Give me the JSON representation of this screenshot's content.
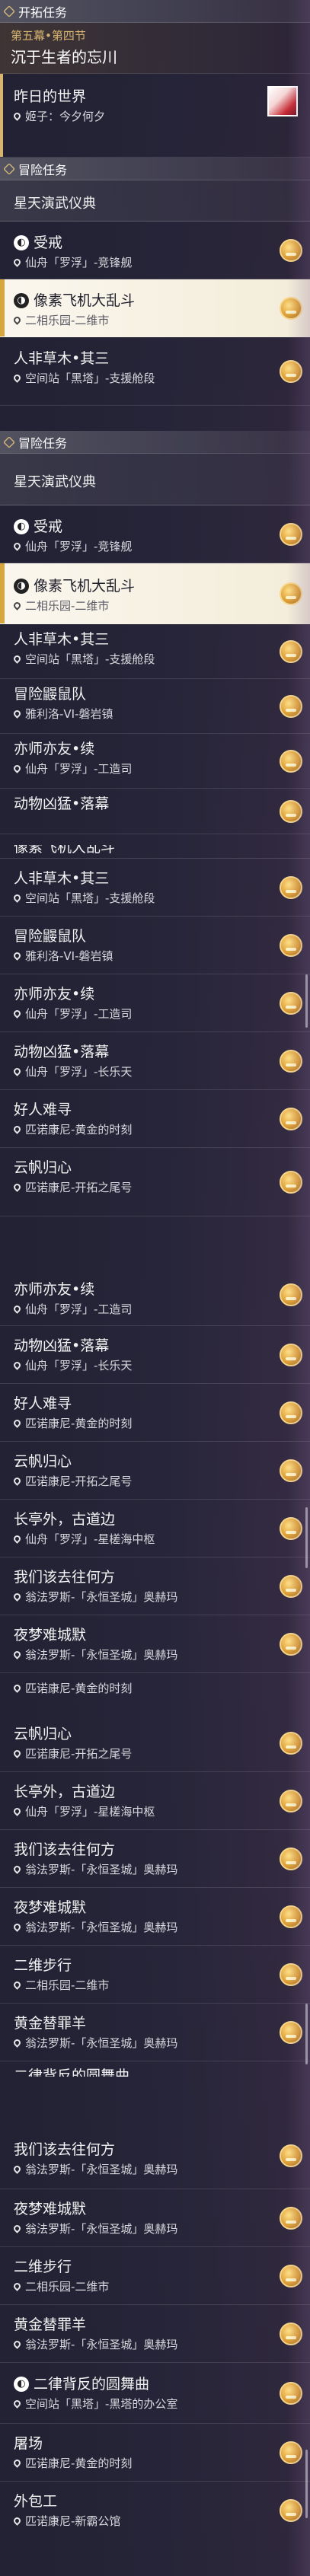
{
  "panel1": {
    "header": "开拓任务",
    "chapter": {
      "label": "第五幕•第四节",
      "title": "沉于生者的忘川"
    },
    "quest": {
      "name": "昨日的世界",
      "location": "姬子：今夕何夕"
    },
    "header2": "冒险任务",
    "group": "星天演武仪典",
    "items": [
      {
        "name": "受戒",
        "location": "仙舟「罗浮」-竞锋舰"
      },
      {
        "name": "像素飞机大乱斗",
        "location": "二相乐园-二维市"
      },
      {
        "name": "人非草木•其三",
        "location": "空间站「黑塔」-支援舱段"
      }
    ]
  },
  "panel2": {
    "header": "冒险任务",
    "group": "星天演武仪典",
    "items": [
      {
        "name": "受戒",
        "location": "仙舟「罗浮」-竞锋舰"
      },
      {
        "name": "像素飞机大乱斗",
        "location": "二相乐园-二维市"
      },
      {
        "name": "人非草木•其三",
        "location": "空间站「黑塔」-支援舱段"
      },
      {
        "name": "冒险鼹鼠队",
        "location": "雅利洛-VI-磐岩镇"
      },
      {
        "name": "亦师亦友•续",
        "location": "仙舟「罗浮」-工造司"
      },
      {
        "name": "动物凶猛•落幕",
        "location": ""
      }
    ]
  },
  "panel3": {
    "cut": "像素飞机大乱斗",
    "items": [
      {
        "name": "人非草木•其三",
        "location": "空间站「黑塔」-支援舱段"
      },
      {
        "name": "冒险鼹鼠队",
        "location": "雅利洛-VI-磐岩镇"
      },
      {
        "name": "亦师亦友•续",
        "location": "仙舟「罗浮」-工造司"
      },
      {
        "name": "动物凶猛•落幕",
        "location": "仙舟「罗浮」-长乐天"
      },
      {
        "name": "好人难寻",
        "location": "匹诺康尼-黄金的时刻"
      },
      {
        "name": "云帆归心",
        "location": "匹诺康尼-开拓之尾号"
      }
    ]
  },
  "panel4": {
    "items": [
      {
        "name": "亦师亦友•续",
        "location": "仙舟「罗浮」-工造司"
      },
      {
        "name": "动物凶猛•落幕",
        "location": "仙舟「罗浮」-长乐天"
      },
      {
        "name": "好人难寻",
        "location": "匹诺康尼-黄金的时刻"
      },
      {
        "name": "云帆归心",
        "location": "匹诺康尼-开拓之尾号"
      },
      {
        "name": "长亭外，古道边",
        "location": "仙舟「罗浮」-星槎海中枢"
      },
      {
        "name": "我们该去往何方",
        "location": "翁法罗斯-「永恒圣城」奥赫玛"
      },
      {
        "name": "夜梦难城默",
        "location": "翁法罗斯-「永恒圣城」奥赫玛"
      }
    ],
    "tail_location": "匹诺康尼-黄金的时刻"
  },
  "panel5": {
    "items": [
      {
        "name": "云帆归心",
        "location": "匹诺康尼-开拓之尾号"
      },
      {
        "name": "长亭外，古道边",
        "location": "仙舟「罗浮」-星槎海中枢"
      },
      {
        "name": "我们该去往何方",
        "location": "翁法罗斯-「永恒圣城」奥赫玛"
      },
      {
        "name": "夜梦难城默",
        "location": "翁法罗斯-「永恒圣城」奥赫玛"
      },
      {
        "name": "二维步行",
        "location": "二相乐园-二维市"
      },
      {
        "name": "黄金替罪羊",
        "location": "翁法罗斯-「永恒圣城」奥赫玛"
      }
    ],
    "cut": "二律背反的圆舞曲"
  },
  "panel6": {
    "items": [
      {
        "name": "我们该去往何方",
        "location": "翁法罗斯-「永恒圣城」奥赫玛"
      },
      {
        "name": "夜梦难城默",
        "location": "翁法罗斯-「永恒圣城」奥赫玛"
      },
      {
        "name": "二维步行",
        "location": "二相乐园-二维市"
      },
      {
        "name": "黄金替罪羊",
        "location": "翁法罗斯-「永恒圣城」奥赫玛"
      },
      {
        "name": "二律背反的圆舞曲",
        "location": "空间站「黑塔」-黑塔的办公室"
      },
      {
        "name": "屠场",
        "location": "匹诺康尼-黄金的时刻"
      },
      {
        "name": "外包工",
        "location": "匹诺康尼-新霸公馆"
      }
    ]
  },
  "colors": {
    "accent": "#d7b46f",
    "selected_bg": "#f3ecd9",
    "reward": "#e0a23a"
  }
}
